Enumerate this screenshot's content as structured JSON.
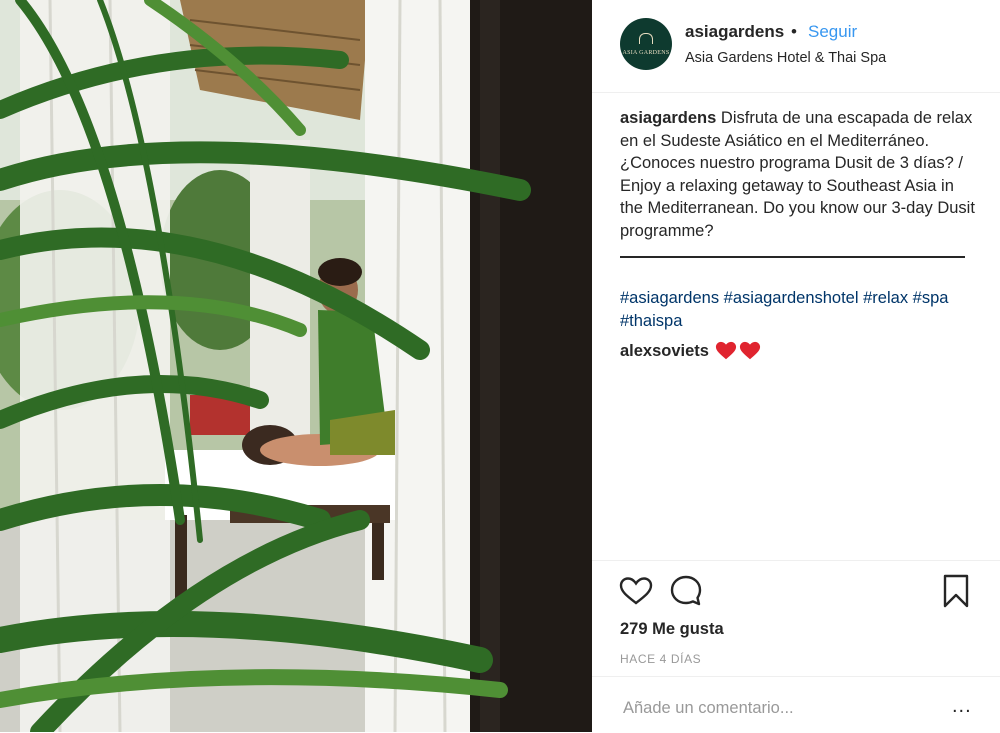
{
  "post": {
    "username": "asiagardens",
    "dot": "•",
    "follow_label": "Seguir",
    "location": "Asia Gardens Hotel & Thai Spa",
    "avatar_text": "ASIA GARDENS",
    "avatar_bg": "#0e3a2f"
  },
  "caption": {
    "username": "asiagardens",
    "text": "Disfruta de una escapada de relax en el Sudeste Asiático en el Mediterráneo. ¿Conoces nuestro programa Dusit de 3 días? / Enjoy a relaxing getaway to Southeast Asia in the Mediterranean. Do you know our 3-day Dusit programme?",
    "hashtags": [
      "#asiagardens",
      "#asiagardenshotel",
      "#relax",
      "#spa",
      "#thaispa"
    ]
  },
  "comments": [
    {
      "username": "alexsoviets",
      "emoji": "heart-emoji",
      "emoji_count": 2
    }
  ],
  "actions": {
    "icons": [
      "heart-icon",
      "comment-icon",
      "bookmark-icon"
    ]
  },
  "likes_text": "279 Me gusta",
  "time_ago": "HACE 4 DÍAS",
  "add_comment": {
    "placeholder": "Añade un comentario...",
    "more": "..."
  },
  "colors": {
    "link_blue": "#3897f0",
    "hashtag_blue": "#003569",
    "text": "#262626",
    "muted": "#999999",
    "divider": "#efefef",
    "heart_red": "#e0242f"
  }
}
